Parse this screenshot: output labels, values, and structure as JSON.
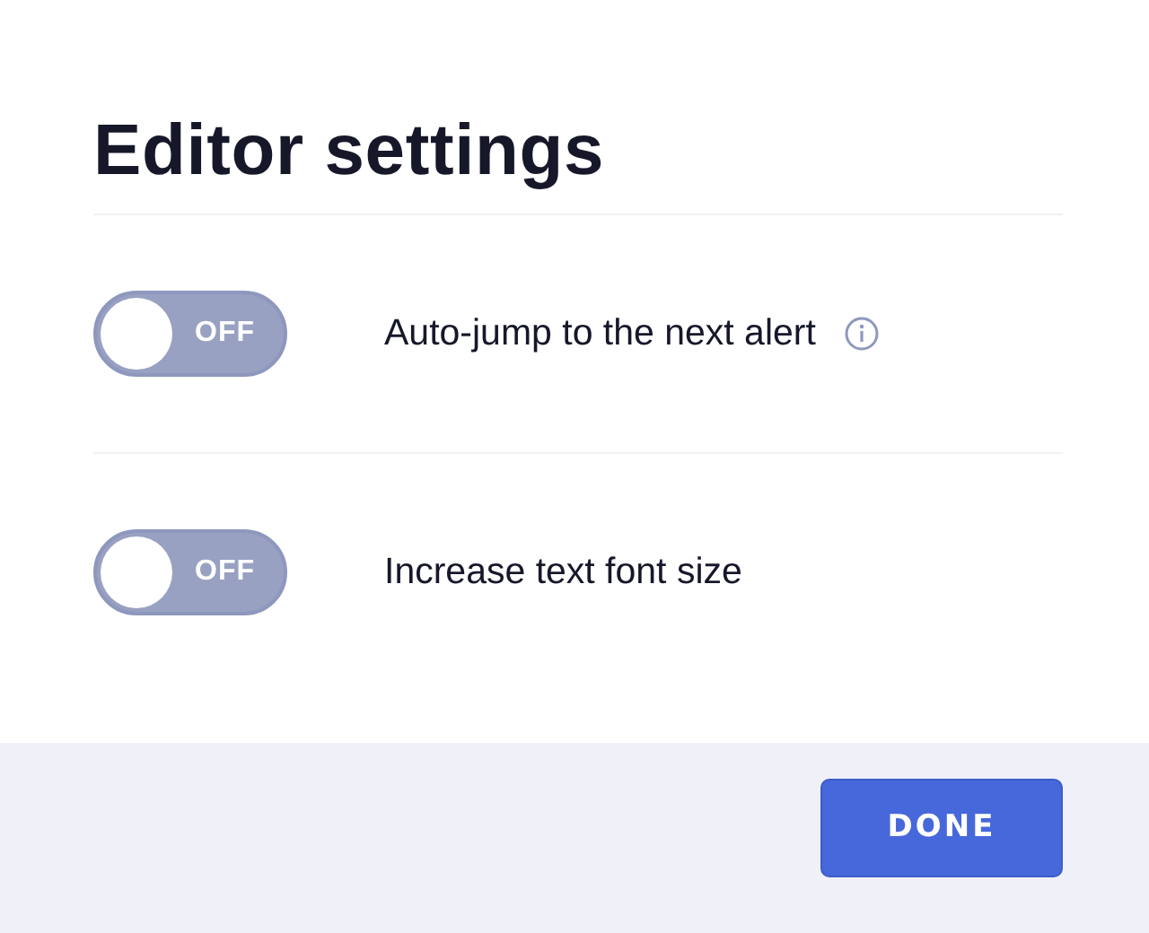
{
  "title": "Editor settings",
  "settings": [
    {
      "label": "Auto-jump to the next alert",
      "on": false,
      "toggle_text": "OFF",
      "info": true
    },
    {
      "label": "Increase text font size",
      "on": false,
      "toggle_text": "OFF",
      "info": false
    }
  ],
  "footer": {
    "button": "DONE"
  }
}
